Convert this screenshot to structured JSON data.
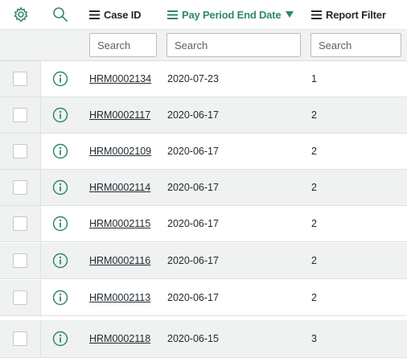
{
  "columns": {
    "case_id": "Case ID",
    "pay_period_end_date": "Pay Period End Date",
    "report_filter": "Report Filter"
  },
  "search_placeholder": "Search",
  "rows": [
    {
      "case_id": "HRM0002134",
      "pay_period_end_date": "2020-07-23",
      "report_filter": "1"
    },
    {
      "case_id": "HRM0002117",
      "pay_period_end_date": "2020-06-17",
      "report_filter": "2"
    },
    {
      "case_id": "HRM0002109",
      "pay_period_end_date": "2020-06-17",
      "report_filter": "2"
    },
    {
      "case_id": "HRM0002114",
      "pay_period_end_date": "2020-06-17",
      "report_filter": "2"
    },
    {
      "case_id": "HRM0002115",
      "pay_period_end_date": "2020-06-17",
      "report_filter": "2"
    },
    {
      "case_id": "HRM0002116",
      "pay_period_end_date": "2020-06-17",
      "report_filter": "2"
    },
    {
      "case_id": "HRM0002113",
      "pay_period_end_date": "2020-06-17",
      "report_filter": "2"
    },
    {
      "case_id": "HRM0002118",
      "pay_period_end_date": "2020-06-15",
      "report_filter": "3"
    }
  ],
  "colors": {
    "accent": "#2f8770",
    "row_alt": "#f0f1f1",
    "text": "#1f2a30"
  },
  "icons": {
    "personalize": "gear-icon",
    "search": "search-icon",
    "column_menu": "menu-icon",
    "sort": "sort-descending-icon",
    "row_preview": "info-icon"
  }
}
